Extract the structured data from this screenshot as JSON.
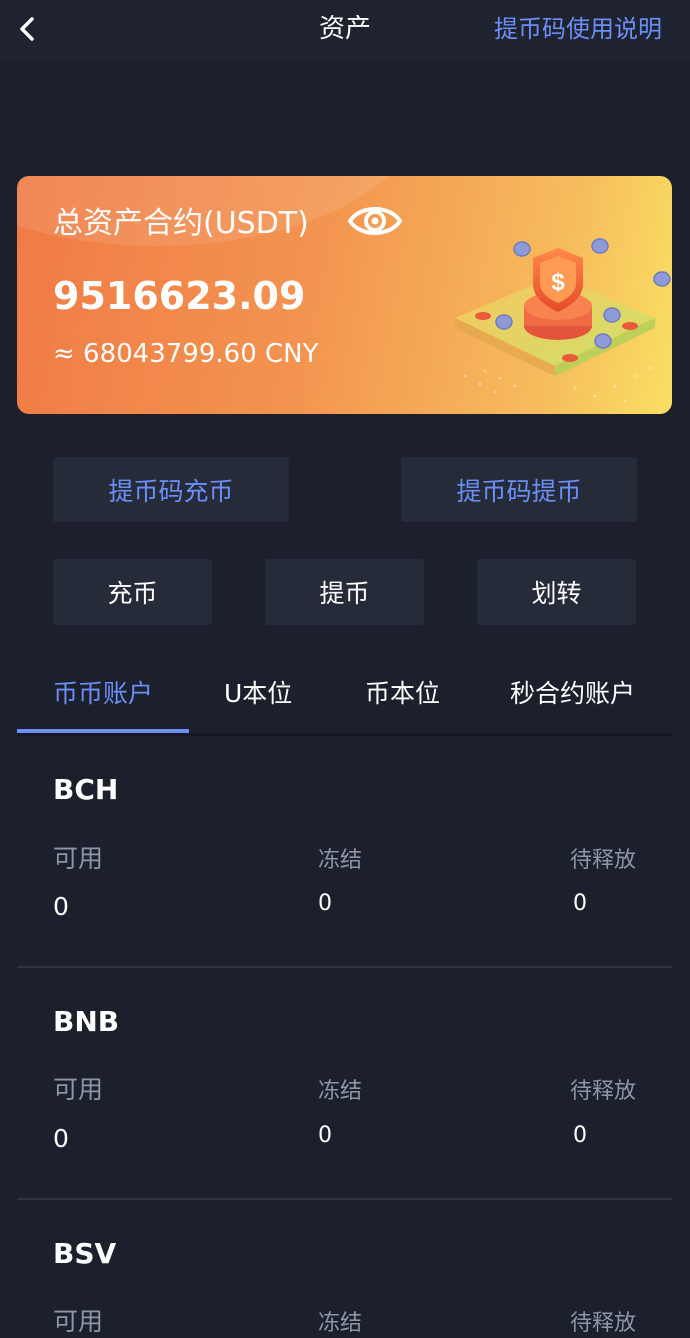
{
  "header": {
    "title": "资产",
    "help_link": "提币码使用说明"
  },
  "asset_card": {
    "label": "总资产合约(USDT)",
    "amount": "9516623.09",
    "cny": "≈ 68043799.60 CNY"
  },
  "actions": {
    "code_deposit": "提币码充币",
    "code_withdraw": "提币码提币",
    "deposit": "充币",
    "withdraw": "提币",
    "transfer": "划转"
  },
  "tabs": [
    {
      "label": "币币账户",
      "active": true
    },
    {
      "label": "U本位",
      "active": false
    },
    {
      "label": "币本位",
      "active": false
    },
    {
      "label": "秒合约账户",
      "active": false
    }
  ],
  "columns": {
    "available": "可用",
    "frozen": "冻结",
    "pending": "待释放"
  },
  "coins": [
    {
      "name": "BCH",
      "available": "0",
      "frozen": "0",
      "pending": "0"
    },
    {
      "name": "BNB",
      "available": "0",
      "frozen": "0",
      "pending": "0"
    },
    {
      "name": "BSV",
      "available": "",
      "frozen": "",
      "pending": ""
    }
  ],
  "colors": {
    "background": "#1b202c",
    "accent": "#6b8ff7",
    "button_bg": "#252b38",
    "card_gradient_start": "#f07a45",
    "card_gradient_end": "#f9df63"
  }
}
